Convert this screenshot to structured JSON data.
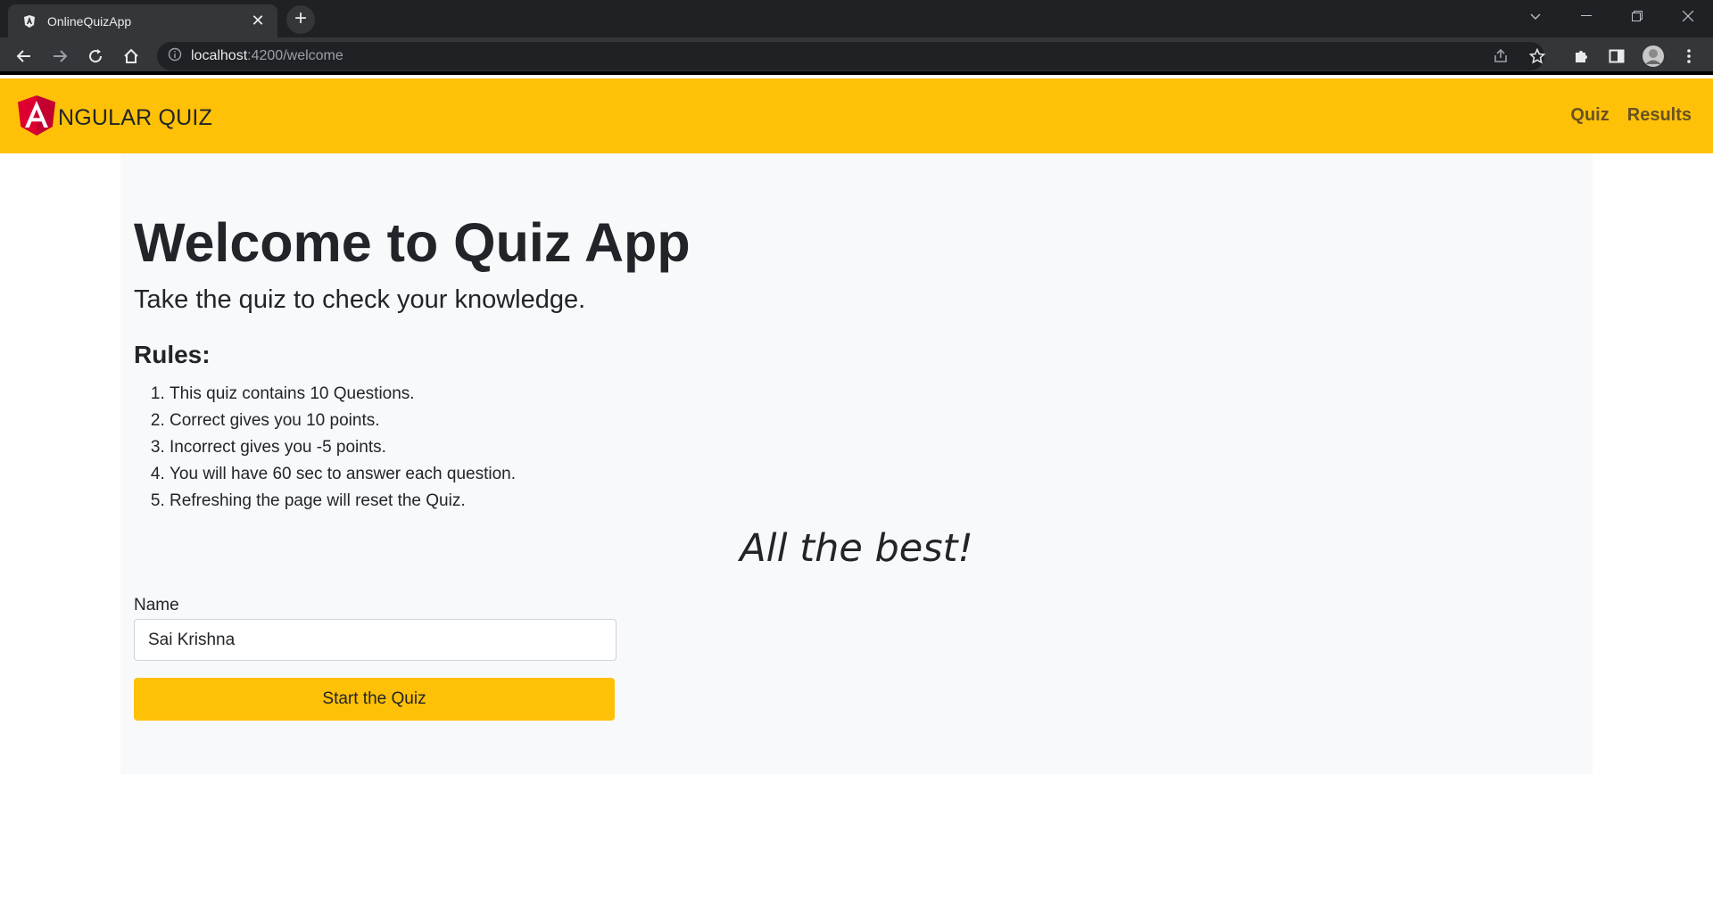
{
  "browser": {
    "tab_title": "OnlineQuizApp",
    "tab_close": "✕",
    "new_tab": "+",
    "url_host": "localhost",
    "url_path": ":4200/welcome"
  },
  "navbar": {
    "brand_text": "NGULAR QUIZ",
    "links": [
      "Quiz",
      "Results"
    ]
  },
  "main": {
    "title": "Welcome to Quiz App",
    "subtitle": "Take the quiz to check your knowledge.",
    "rules_heading": "Rules:",
    "rules": [
      "This quiz contains 10 Questions.",
      "Correct gives you 10 points.",
      "Incorrect gives you -5 points.",
      "You will have 60 sec to answer each question.",
      "Refreshing the page will reset the Quiz."
    ],
    "best_wishes": "All the best!",
    "name_label": "Name",
    "name_value": "Sai Krishna",
    "start_button": "Start the Quiz"
  },
  "colors": {
    "accent": "#ffc107",
    "angular_red": "#dd0031"
  }
}
